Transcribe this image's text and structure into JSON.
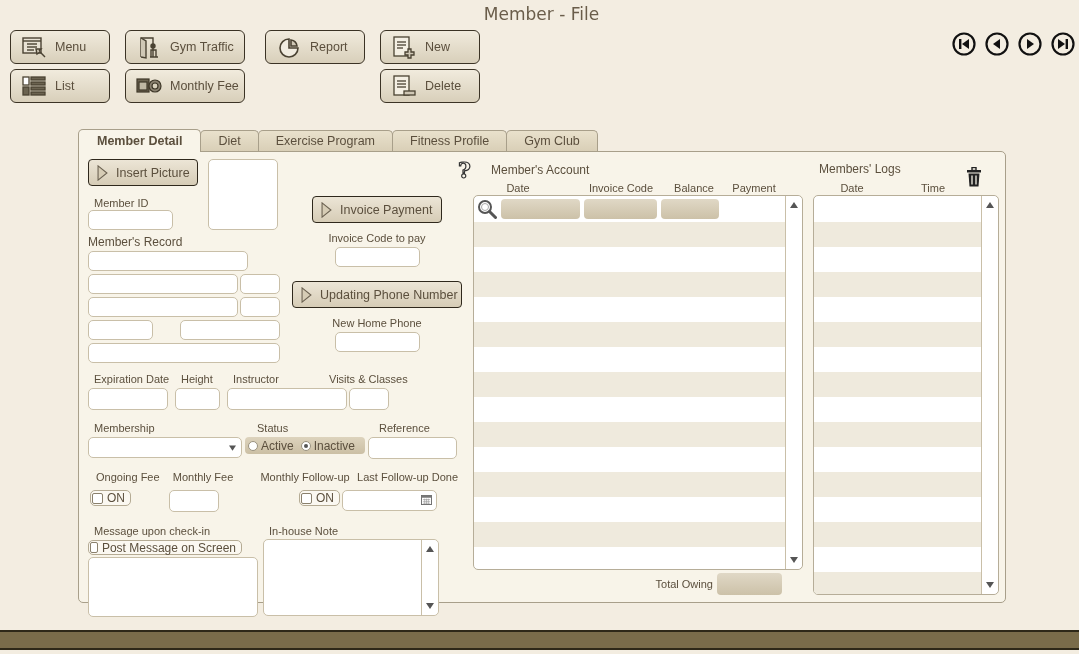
{
  "window": {
    "title": "Member - File"
  },
  "toolbar": {
    "columns": [
      [
        {
          "label": "Menu",
          "kind": "menu"
        },
        {
          "label": "List",
          "kind": "list"
        }
      ],
      [
        {
          "label": "Gym Traffic",
          "kind": "traffic"
        },
        {
          "label": "Monthly Fee",
          "kind": "fee"
        }
      ],
      [
        {
          "label": "Report",
          "kind": "report"
        }
      ],
      [
        {
          "label": "New",
          "kind": "new"
        },
        {
          "label": "Delete",
          "kind": "delete"
        }
      ]
    ]
  },
  "tabs": [
    {
      "label": "Member Detail",
      "selected": true
    },
    {
      "label": "Diet",
      "selected": false
    },
    {
      "label": "Exercise Program",
      "selected": false
    },
    {
      "label": "Fitness Profile",
      "selected": false
    },
    {
      "label": "Gym Club",
      "selected": false
    }
  ],
  "detail": {
    "insert_picture": "Insert Picture",
    "member_id": "Member ID",
    "members_record": "Member's Record",
    "invoice_payment": "Invoice Payment",
    "invoice_code": "Invoice Code to pay",
    "update_phone": "Updating Phone Number",
    "new_home_phone": "New Home Phone",
    "expiration_date": "Expiration Date",
    "height": "Height",
    "instructor": "Instructor",
    "visits_classes": "Visits & Classes",
    "membership": "Membership",
    "status": {
      "label": "Status",
      "options": [
        {
          "label": "Active",
          "selected": false
        },
        {
          "label": "Inactive",
          "selected": true
        }
      ]
    },
    "reference": "Reference",
    "ongoing_fee": {
      "label": "Ongoing Fee",
      "checkbox": "ON",
      "checked": false
    },
    "monthly_fee": "Monthly Fee",
    "monthly_followup": {
      "label": "Monthly Follow-up",
      "checkbox": "ON",
      "checked": false
    },
    "last_followup": "Last Follow-up Done",
    "message": {
      "label": "Message upon check-in",
      "checkbox": "Post Message on Screen",
      "checked": false
    },
    "inhouse_note": "In-house Note"
  },
  "account": {
    "help": "?",
    "title": "Member's Account",
    "columns": [
      "Date",
      "Invoice Code",
      "Balance",
      "Payment"
    ],
    "total_label": "Total Owing"
  },
  "logs": {
    "title": "Members' Logs",
    "columns": [
      "Date",
      "Time"
    ]
  }
}
